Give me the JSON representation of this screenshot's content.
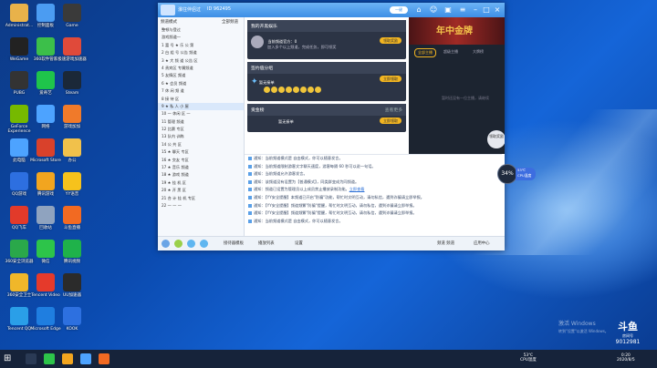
{
  "desktop": {
    "icons": [
      {
        "label": "Administrat...",
        "color": "#e8b24a"
      },
      {
        "label": "WeGame",
        "color": "#222222"
      },
      {
        "label": "PUBG",
        "color": "#333333"
      },
      {
        "label": "GeForce Experience",
        "color": "#76b900"
      },
      {
        "label": "此电脑",
        "color": "#4da3ff"
      },
      {
        "label": "QQ游戏",
        "color": "#2d6fe0"
      },
      {
        "label": "QQ飞车",
        "color": "#e23a2a"
      },
      {
        "label": "360安全浏览器",
        "color": "#2aa84a"
      },
      {
        "label": "360安全卫士",
        "color": "#f0b72a"
      },
      {
        "label": "Tencent QQ",
        "color": "#2a9fe8"
      },
      {
        "label": "控制面板",
        "color": "#4b9cf2"
      },
      {
        "label": "360软件管家",
        "color": "#3cbf4a"
      },
      {
        "label": "爱奇艺",
        "color": "#1fc44b"
      },
      {
        "label": "网络",
        "color": "#4da3ff"
      },
      {
        "label": "Microsoft Store",
        "color": "#d9412b"
      },
      {
        "label": "腾讯游戏",
        "color": "#f2a51f"
      },
      {
        "label": "回收站",
        "color": "#8fa3bf"
      },
      {
        "label": "微信",
        "color": "#2dc44a"
      },
      {
        "label": "Tencent Video",
        "color": "#e53a2b"
      },
      {
        "label": "Microsoft Edge",
        "color": "#1f7ee0"
      },
      {
        "label": "Game",
        "color": "#3a3a3a"
      },
      {
        "label": "极速游戏加速器",
        "color": "#e04a3a"
      },
      {
        "label": "Steam",
        "color": "#1b2838"
      },
      {
        "label": "游戏加加",
        "color": "#f07a2a"
      },
      {
        "label": "办公",
        "color": "#f1c14b"
      },
      {
        "label": "YY语音",
        "color": "#f6c21c"
      },
      {
        "label": "斗鱼直播",
        "color": "#f26a22"
      },
      {
        "label": "腾讯视频",
        "color": "#1fb24a"
      },
      {
        "label": "UU加速器",
        "color": "#2b2b2b"
      },
      {
        "label": "KOOK",
        "color": "#2d70e0"
      }
    ],
    "activate": {
      "line1": "激活 Windows",
      "line2": "转到\"设置\"以激活 Windows。"
    },
    "douyu": {
      "logo": "斗鱼",
      "room_label": "房间号",
      "room_id": "9012981"
    }
  },
  "chat": {
    "title": "瀑往伴侣过",
    "title_id": "ID 962495",
    "pill": "一键",
    "left": {
      "header": "频道模式",
      "header_right": "全部频道",
      "channels": [
        "整顿与登过",
        "游戏频道一",
        "1 富 号 ★ 乐 公 第",
        "2 白 组  号 公告 频道",
        "3 ★ 大 频 道 公告 区",
        "4 贵宾区 专属频道",
        "5 友情区 频道",
        "6 ★ 会员 频道",
        "7 休 闲 频 道",
        "8 接 待 区",
        "9 ★ 私 人 小 屋",
        "10 一 休闲 区 一",
        "11 管理 频道",
        "12 比赛 专区",
        "13 队内 训练",
        "14 公 共 区",
        "15 ★ 聊天 专区",
        "16 ★ 交友 专区",
        "17 ★ 音乐 频道",
        "18 ★ 游戏 频道",
        "19 ★ 挂 机 区",
        "20 ★ 开 黑 区",
        "21 合 计 挂 机 专区",
        "22 一 一 一"
      ]
    },
    "center": {
      "panel1": {
        "title": "我的开黑娱乐",
        "text": "当前频道官方：0",
        "sub": "加入多个以上频道，完成任务，即可领奖",
        "btn": "领取奖励"
      },
      "panel2": {
        "title": "签约值分组",
        "text": "暂无接单",
        "btn": "立即领取"
      },
      "panel3": {
        "title": "贡金榜",
        "more": "查看更多",
        "text": "暂无接单",
        "btn": "立即领取"
      }
    },
    "banner": {
      "headline": "年中金牌",
      "tabs": [
        "全部主播",
        "超级主播",
        "大牌榜"
      ],
      "empty": "暂时还没有一位主播，请继续",
      "fab": "领取奖励"
    },
    "messages": [
      "通知：当前频道模式是 自由模式，你可以随意发言。",
      "通知：当前频道限制游客文字聊天速度，游客每隔 60 秒可以说一句话。",
      "通知：当前频道允许游客发言。",
      "通知：该频道没有设置为【普通模式】，同类群变成为同频道。",
      "通知：频道已设置为管理员以上成员禁止播放录制功能。",
      "通知：【YY安全提醒】本频道已开启\"防骗\"功能，帮忙时文明互动，请勿私信，遇到诈骗请立即举报。",
      "通知：【YY安全提醒】频道频繁\"防骗\"提醒，帮忙时文明互动，请勿私信，遇到诈骗请立即举报。",
      "通知：【YY安全提醒】频道频繁\"防骗\"提醒，帮忙时文明互动，请勿私信，遇到诈骗请立即举报。",
      "通知：当前频道模式是 自由模式，你可以随意发言。"
    ],
    "link_text": "立即查看",
    "bottom": {
      "item1": "接待器模板",
      "item2": "播放列表",
      "item3": "设置",
      "right1": "频道 频道",
      "right2": "应用中心"
    }
  },
  "speed": {
    "value": "34",
    "unit": "%",
    "temp": "53℃",
    "label": "CPU温度"
  },
  "taskbar": {
    "temp": "53℃",
    "temp_label": "CPU温度",
    "time": "0:20",
    "date": "2020/8/5"
  }
}
